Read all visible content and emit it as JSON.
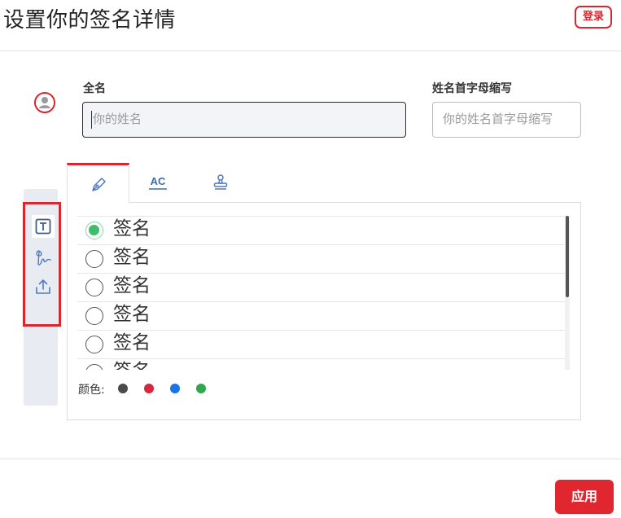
{
  "header": {
    "title": "设置你的签名详情",
    "login_label": "登录"
  },
  "form": {
    "full_name_label": "全名",
    "full_name_placeholder": "你的姓名",
    "initials_label": "姓名首字母缩写",
    "initials_placeholder": "你的姓名首字母缩写"
  },
  "side_toolbar": {
    "items": [
      {
        "icon": "text-icon",
        "active": true
      },
      {
        "icon": "signature-draw-icon",
        "active": false
      },
      {
        "icon": "upload-icon",
        "active": false
      }
    ]
  },
  "tabs": [
    {
      "icon": "pen-icon",
      "active": true
    },
    {
      "icon": "initials-ac-icon",
      "label": "AC",
      "active": false
    },
    {
      "icon": "stamp-icon",
      "active": false
    }
  ],
  "signatures": {
    "options": [
      {
        "label": "签名",
        "selected": true
      },
      {
        "label": "签名",
        "selected": false
      },
      {
        "label": "签名",
        "selected": false
      },
      {
        "label": "签名",
        "selected": false
      },
      {
        "label": "签名",
        "selected": false
      },
      {
        "label": "签名",
        "selected": false
      }
    ]
  },
  "colors": {
    "label": "颜色:",
    "swatches": [
      "#4a4a4a",
      "#d7263d",
      "#1a73e8",
      "#2ea84a"
    ]
  },
  "footer": {
    "apply_label": "应用"
  },
  "accent": {
    "brand_red": "#d9272e",
    "radio_green": "#3ebd6a"
  }
}
